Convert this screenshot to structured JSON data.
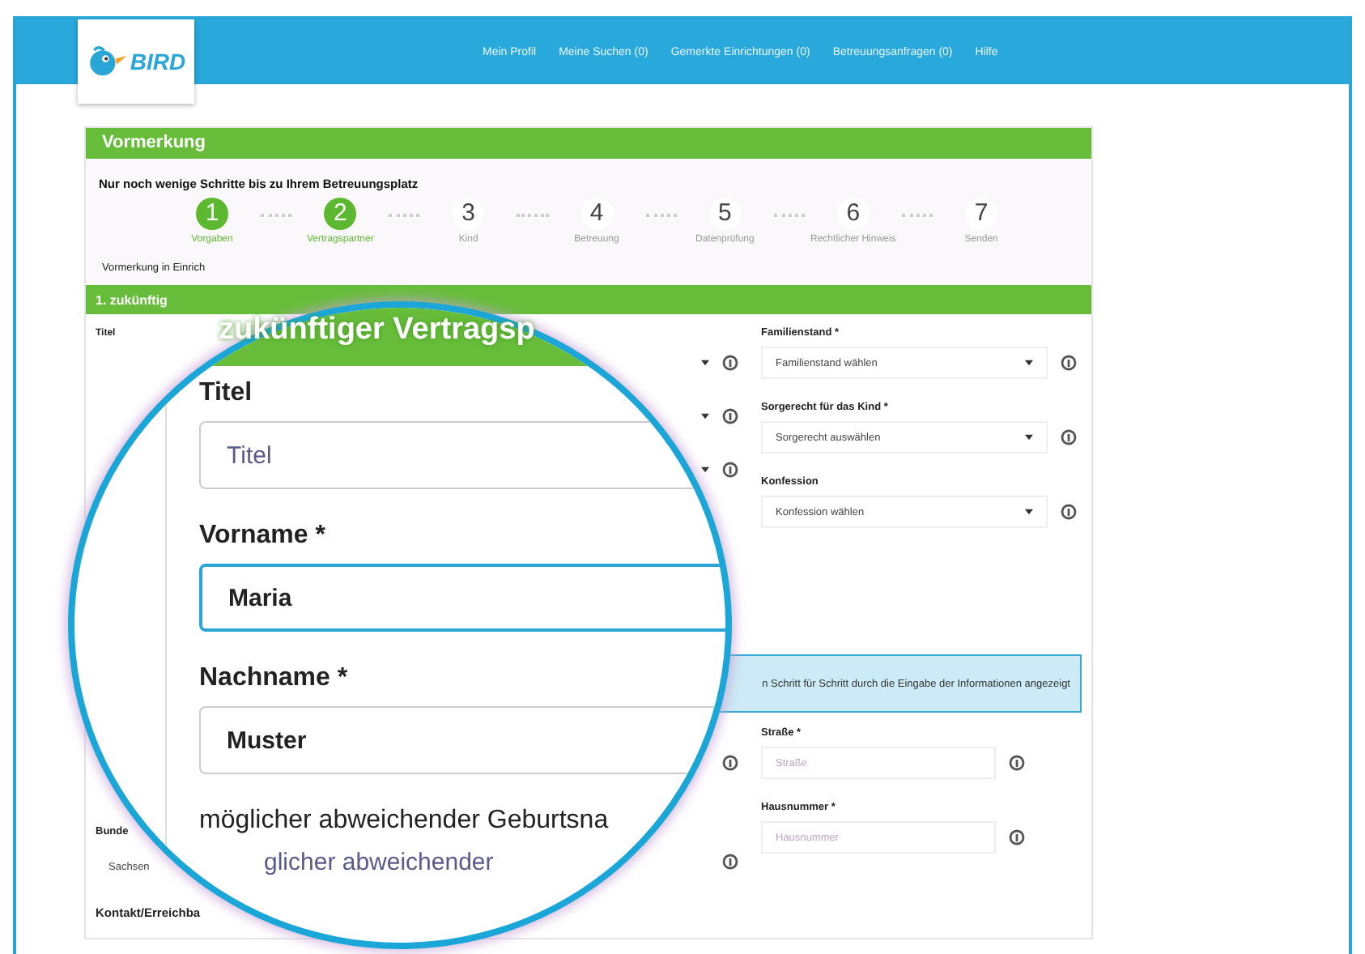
{
  "header": {
    "logo_text": "BIRD",
    "nav": [
      "Mein Profil",
      "Meine Suchen (0)",
      "Gemerkte Einrichtungen (0)",
      "Betreuungsanfragen (0)",
      "Hilfe"
    ]
  },
  "card": {
    "title": "Vormerkung",
    "subtitle": "Nur noch wenige Schritte bis zu Ihrem Betreuungsplatz",
    "steps": [
      {
        "number": "1",
        "label": "Vorgaben",
        "done": true
      },
      {
        "number": "2",
        "label": "Vertragspartner",
        "done": true
      },
      {
        "number": "3",
        "label": "Kind",
        "done": false
      },
      {
        "number": "4",
        "label": "Betreuung",
        "done": false
      },
      {
        "number": "5",
        "label": "Datenprüfung",
        "done": false
      },
      {
        "number": "6",
        "label": "Rechtlicher Hinweis",
        "done": false
      },
      {
        "number": "7",
        "label": "Senden",
        "done": false
      }
    ],
    "breadcrumb": "Vormerkung in Einrich",
    "section_title": "1. zukünftig",
    "left_top": {
      "label": "Titel"
    },
    "right_top": [
      {
        "label": "Familienstand *",
        "value": "Familienstand wählen"
      },
      {
        "label": "Sorgerecht für das Kind *",
        "value": "Sorgerecht auswählen"
      },
      {
        "label": "Konfession",
        "value": "Konfession wählen"
      }
    ],
    "info": "n Schritt für Schritt durch die Eingabe der Informationen angezeigt",
    "left_bottom": {
      "label": "Bunde",
      "value": "Sachsen"
    },
    "right_bottom": [
      {
        "label": "Straße *",
        "placeholder": "Straße"
      },
      {
        "label": "Hausnummer *",
        "placeholder": "Hausnummer"
      }
    ],
    "contact_heading": "Kontakt/Erreichba"
  },
  "magnifier": {
    "heading": "zukünftiger Vertragsp",
    "fields": [
      {
        "label": "Titel",
        "placeholder": "Titel",
        "focused": false
      },
      {
        "label": "Vorname *",
        "value": "Maria",
        "focused": true
      },
      {
        "label": "Nachname *",
        "value": "Muster",
        "focused": false
      },
      {
        "label": "möglicher abweichender Geburtsna",
        "placeholder": "glicher abweichender"
      }
    ]
  }
}
